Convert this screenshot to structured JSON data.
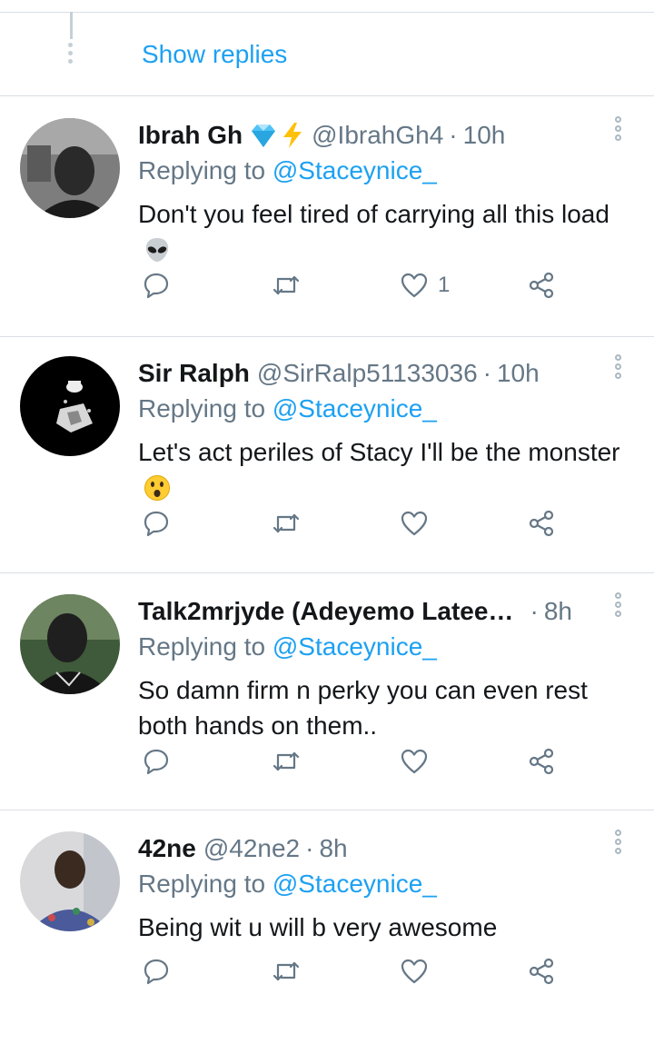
{
  "thread": {
    "show_replies": "Show replies"
  },
  "tweets": [
    {
      "name": "Ibrah Gh",
      "badges": [
        "diamond-emoji",
        "lightning-emoji"
      ],
      "handle": "@IbrahGh4",
      "time": "10h",
      "replying_prefix": "Replying to",
      "replying_to": "@Staceynice_",
      "text": "Don't you feel tired of carrying all this load",
      "emoji": "alien-emoji",
      "like_count": "1"
    },
    {
      "name": "Sir Ralph",
      "handle": "@SirRalp51133036",
      "time": "10h",
      "replying_prefix": "Replying to",
      "replying_to": "@Staceynice_",
      "text": "Let's act periles of Stacy I'll be the monster",
      "emoji": "astonished-face-emoji",
      "like_count": ""
    },
    {
      "name": "Talk2mrjyde (Adeyemo Lateef ...",
      "handle": "",
      "time": "8h",
      "replying_prefix": "Replying to",
      "replying_to": "@Staceynice_",
      "text": "So damn firm n perky you can even rest both hands on them..",
      "like_count": ""
    },
    {
      "name": "42ne",
      "handle": "@42ne2",
      "time": "8h",
      "replying_prefix": "Replying to",
      "replying_to": "@Staceynice_",
      "text": "Being wit u will b very awesome",
      "like_count": ""
    }
  ],
  "colors": {
    "accent": "#1da1f2",
    "muted": "#657786",
    "text": "#14171a",
    "divider": "#dadfe3"
  }
}
